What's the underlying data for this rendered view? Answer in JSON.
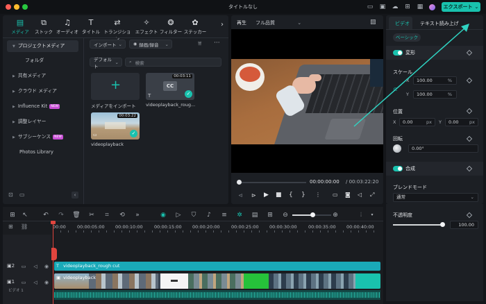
{
  "window": {
    "title": "タイトルなし",
    "export_label": "エクスポート"
  },
  "media_toolbar": {
    "tabs": [
      {
        "label": "メディア",
        "icon": "media-icon"
      },
      {
        "label": "ストック",
        "icon": "stock-icon"
      },
      {
        "label": "オーディオ",
        "icon": "audio-icon"
      },
      {
        "label": "タイトル",
        "icon": "title-icon"
      },
      {
        "label": "トランジション",
        "icon": "transition-icon"
      },
      {
        "label": "エフェクト",
        "icon": "effect-icon"
      },
      {
        "label": "フィルター",
        "icon": "filter-icon"
      },
      {
        "label": "ステッカー",
        "icon": "sticker-icon"
      }
    ]
  },
  "sidebar": {
    "items": [
      {
        "label": "プロジェクトメディア",
        "active": true
      },
      {
        "label": "フォルダ"
      },
      {
        "label": "共有メディア"
      },
      {
        "label": "クラウド メディア"
      },
      {
        "label": "Influence Kit",
        "badge": "NEW"
      },
      {
        "label": "調整レイヤー"
      },
      {
        "label": "サブシーケンス",
        "badge": "NEW"
      },
      {
        "label": "Photos Library"
      }
    ]
  },
  "media": {
    "import_label": "インポート",
    "record_label": "録画/録音",
    "sort_label": "デフォルト",
    "search_placeholder": "検索",
    "items": [
      {
        "name": "メディアをインポート"
      },
      {
        "name": "videoplayback_roug...",
        "duration": "00:03:11"
      },
      {
        "name": "videoplayback",
        "duration": "00:03:22"
      }
    ],
    "cc_label": "CC"
  },
  "player": {
    "tab_label": "再生",
    "quality_label": "フル品質",
    "current_time": "00:00:00:00",
    "total_time": "/ 00:03:22:20"
  },
  "properties": {
    "tabs": [
      "ビデオ",
      "テキスト読み上げ"
    ],
    "basic_label": "ベーシック",
    "transform_label": "変形",
    "scale_label": "スケール",
    "scale_x": "100.00",
    "scale_y": "100.00",
    "percent": "%",
    "position_label": "位置",
    "pos_x": "0.00",
    "pos_y": "0.00",
    "px": "px",
    "rotation_label": "回転",
    "rotation_value": "0.00°",
    "composite_label": "合成",
    "blend_label": "ブレンドモード",
    "blend_value": "通常",
    "opacity_label": "不透明度",
    "opacity_value": "100.00",
    "opacity_level": 1.0,
    "x_label": "X",
    "y_label": "Y"
  },
  "timeline": {
    "ruler": [
      "00:00",
      "00:00:05:00",
      "00:00:10:00",
      "00:00:15:00",
      "00:00:20:00",
      "00:00:25:00",
      "00:00:30:00",
      "00:00:35:00",
      "00:00:40:00"
    ],
    "tracks": [
      {
        "number": "2",
        "clip": "videoplayback_rough cut"
      },
      {
        "number": "1",
        "clip": "videoplayback",
        "name": "ビデオ 1"
      }
    ]
  },
  "colors": {
    "accent": "#19c2ae",
    "arrow": "#2fd3c2",
    "playhead": "#e0453e"
  }
}
